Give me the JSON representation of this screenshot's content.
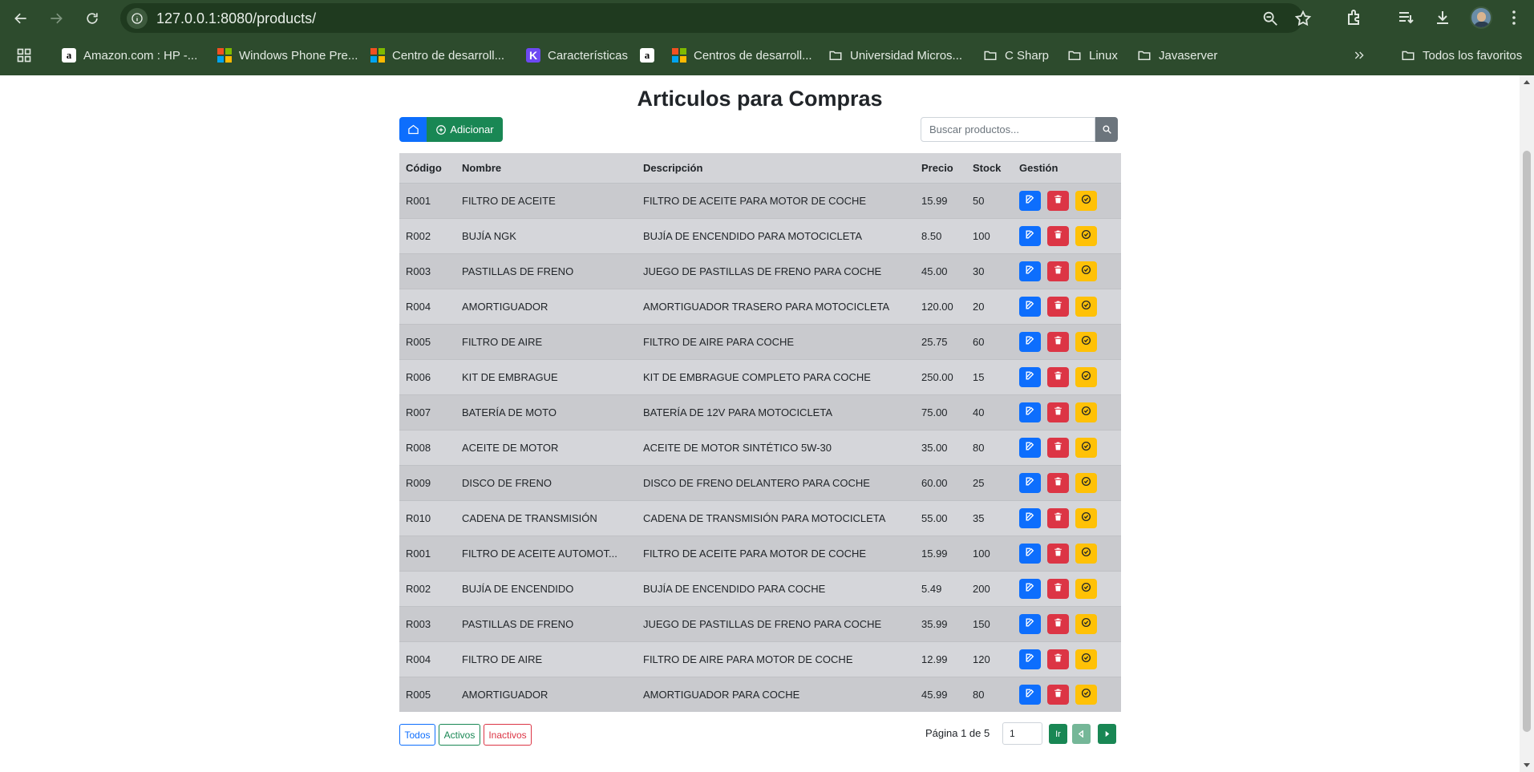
{
  "browser": {
    "url": "127.0.0.1:8080/products/",
    "bookmarks": [
      {
        "label": "Amazon.com : HP -...",
        "icon": "amazon-icon"
      },
      {
        "label": "Windows Phone Pre...",
        "icon": "microsoft-icon"
      },
      {
        "label": "Centro de desarroll...",
        "icon": "microsoft-icon"
      },
      {
        "label": "Características",
        "icon": "k-icon"
      },
      {
        "label": "",
        "icon": "amazon-icon"
      },
      {
        "label": "Centros de desarroll...",
        "icon": "microsoft-icon"
      },
      {
        "label": "Universidad Micros...",
        "icon": "folder-icon"
      },
      {
        "label": "C Sharp",
        "icon": "folder-icon"
      },
      {
        "label": "Linux",
        "icon": "folder-icon"
      },
      {
        "label": "Javaserver",
        "icon": "folder-icon"
      }
    ],
    "all_bookmarks_label": "Todos los favoritos"
  },
  "page": {
    "title": "Articulos para Compras",
    "add_label": "Adicionar",
    "search_placeholder": "Buscar productos...",
    "columns": [
      "Código",
      "Nombre",
      "Descripción",
      "Precio",
      "Stock",
      "Gestión"
    ],
    "rows": [
      {
        "code": "R001",
        "name": "FILTRO DE ACEITE",
        "description": "FILTRO DE ACEITE PARA MOTOR DE COCHE",
        "price": "15.99",
        "stock": "50"
      },
      {
        "code": "R002",
        "name": "BUJÍA NGK",
        "description": "BUJÍA DE ENCENDIDO PARA MOTOCICLETA",
        "price": "8.50",
        "stock": "100"
      },
      {
        "code": "R003",
        "name": "PASTILLAS DE FRENO",
        "description": "JUEGO DE PASTILLAS DE FRENO PARA COCHE",
        "price": "45.00",
        "stock": "30"
      },
      {
        "code": "R004",
        "name": "AMORTIGUADOR",
        "description": "AMORTIGUADOR TRASERO PARA MOTOCICLETA",
        "price": "120.00",
        "stock": "20"
      },
      {
        "code": "R005",
        "name": "FILTRO DE AIRE",
        "description": "FILTRO DE AIRE PARA COCHE",
        "price": "25.75",
        "stock": "60"
      },
      {
        "code": "R006",
        "name": "KIT DE EMBRAGUE",
        "description": "KIT DE EMBRAGUE COMPLETO PARA COCHE",
        "price": "250.00",
        "stock": "15"
      },
      {
        "code": "R007",
        "name": "BATERÍA DE MOTO",
        "description": "BATERÍA DE 12V PARA MOTOCICLETA",
        "price": "75.00",
        "stock": "40"
      },
      {
        "code": "R008",
        "name": "ACEITE DE MOTOR",
        "description": "ACEITE DE MOTOR SINTÉTICO 5W-30",
        "price": "35.00",
        "stock": "80"
      },
      {
        "code": "R009",
        "name": "DISCO DE FRENO",
        "description": "DISCO DE FRENO DELANTERO PARA COCHE",
        "price": "60.00",
        "stock": "25"
      },
      {
        "code": "R010",
        "name": "CADENA DE TRANSMISIÓN",
        "description": "CADENA DE TRANSMISIÓN PARA MOTOCICLETA",
        "price": "55.00",
        "stock": "35"
      },
      {
        "code": "R001",
        "name": "FILTRO DE ACEITE AUTOMOT...",
        "description": "FILTRO DE ACEITE PARA MOTOR DE COCHE",
        "price": "15.99",
        "stock": "100"
      },
      {
        "code": "R002",
        "name": "BUJÍA DE ENCENDIDO",
        "description": "BUJÍA DE ENCENDIDO PARA COCHE",
        "price": "5.49",
        "stock": "200"
      },
      {
        "code": "R003",
        "name": "PASTILLAS DE FRENO",
        "description": "JUEGO DE PASTILLAS DE FRENO PARA COCHE",
        "price": "35.99",
        "stock": "150"
      },
      {
        "code": "R004",
        "name": "FILTRO DE AIRE",
        "description": "FILTRO DE AIRE PARA MOTOR DE COCHE",
        "price": "12.99",
        "stock": "120"
      },
      {
        "code": "R005",
        "name": "AMORTIGUADOR",
        "description": "AMORTIGUADOR PARA COCHE",
        "price": "45.99",
        "stock": "80"
      }
    ],
    "filters": {
      "all": "Todos",
      "active": "Activos",
      "inactive": "Inactivos"
    },
    "pagination": {
      "label": "Página 1 de 5",
      "page_value": "1",
      "go_label": "Ir"
    }
  },
  "colors": {
    "chrome_bg": "#2d4b2d",
    "primary": "#0d6efd",
    "success": "#198754",
    "danger": "#dc3545",
    "warning": "#ffc107"
  }
}
